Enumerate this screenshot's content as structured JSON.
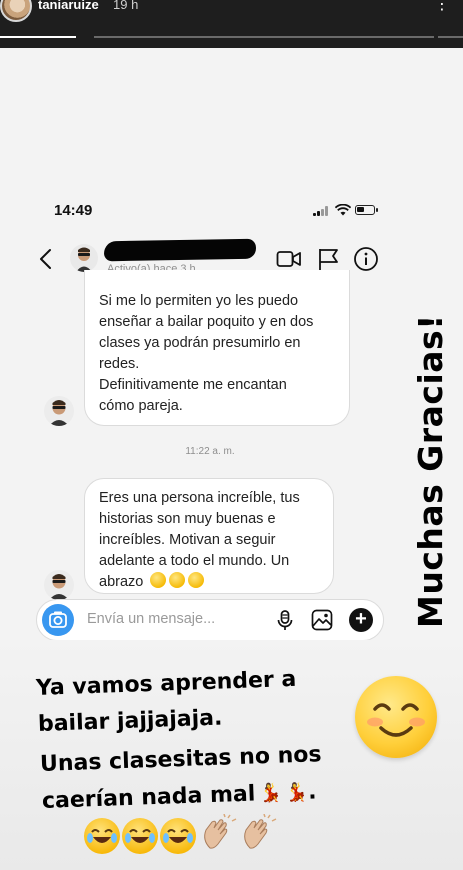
{
  "story": {
    "username": "taniaruize",
    "time_ago": "19 h",
    "segments_total": 3,
    "segment_active": 1
  },
  "phone_status": {
    "time": "14:49"
  },
  "chat_header": {
    "status": "Activo(a) hace 3 h"
  },
  "messages": [
    {
      "text": "Si me lo permiten yo les puedo\nenseñar a bailar poquito y en dos\nclases ya podrán presumirlo en\nredes.\nDefinitivamente me encantan\ncómo pareja."
    },
    {
      "text": "Eres una persona increíble, tus\nhistorias son muy buenas e\nincreíbles. Motivan a seguir\nadelante a todo el mundo. Un\nabrazo"
    }
  ],
  "timestamp": "11:22 a. m.",
  "composer": {
    "placeholder": "Envía un mensaje..."
  },
  "sticker_text": "Muchas Gracias!",
  "caption_lines": [
    "Ya vamos aprender a",
    "bailar jajjajaja.",
    "Unas clasesitas no nos",
    "caerían nada mal"
  ],
  "colors": {
    "story_bar": "#1e1e1e",
    "accent_blue": "#3897f0",
    "bubble_border": "#dbdbdb",
    "background": "#f3f3f3"
  },
  "icons": [
    "back-arrow-icon",
    "video-camera-icon",
    "flag-icon",
    "info-icon",
    "camera-icon",
    "microphone-icon",
    "gallery-icon",
    "plus-icon",
    "wink-emoji-icon",
    "dancer-emoji-icon",
    "blush-emoji-icon",
    "laughing-emoji-icon",
    "clapping-hands-icon"
  ]
}
